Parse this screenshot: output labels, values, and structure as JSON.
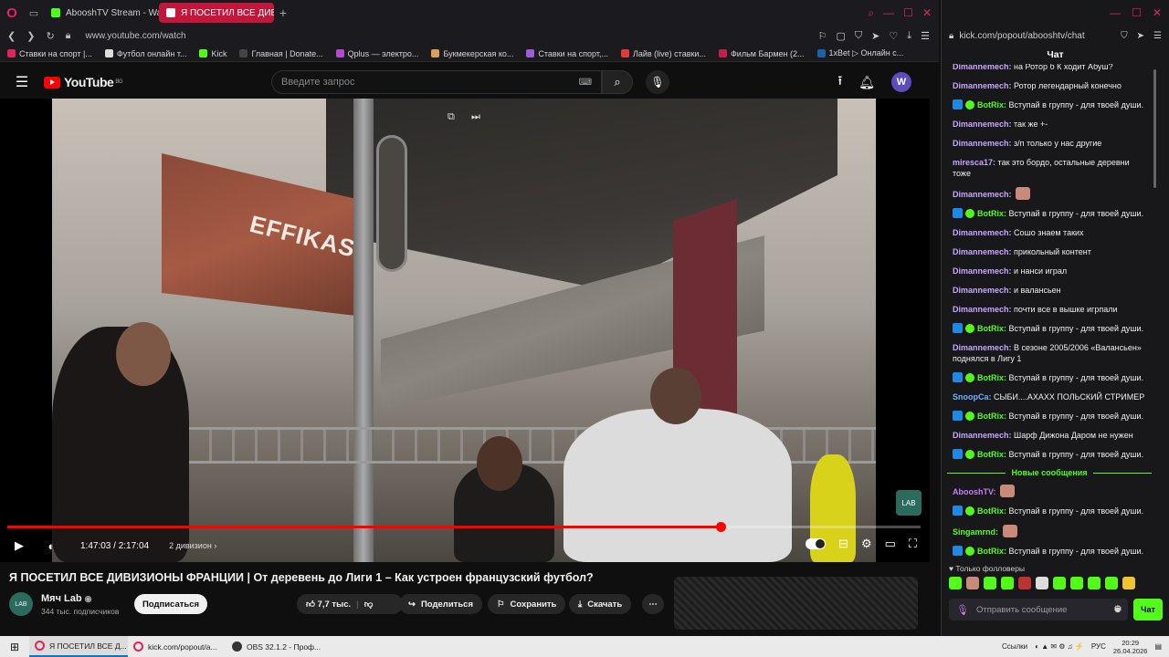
{
  "browser_tabs": [
    {
      "label": "AbooshTV Stream - Watch",
      "active": false
    },
    {
      "label": "Я ПОСЕТИЛ ВСЕ ДИВИЗИОНЫ",
      "active": true
    }
  ],
  "address": {
    "url": "www.youtube.com/watch"
  },
  "bookmarks": [
    "Ставки на спорт |...",
    "Футбол онлайн т...",
    "Kick",
    "Главная | Donate...",
    "Qplus — электро...",
    "Букмекерская ко...",
    "Ставки на спорт,...",
    "Лайв (live) ставки...",
    "Фильм Бармен (2...",
    "1xBet ▷ Онлайн с..."
  ],
  "youtube": {
    "logo_text": "YouTube",
    "region": "BG",
    "search_placeholder": "Введите запрос",
    "avatar_letter": "W"
  },
  "video": {
    "board_text": "EFFIKASS",
    "current_time": "1:47:03",
    "duration": "2:17:04",
    "time_display": "1:47:03 / 2:17:04",
    "chapter": "2 дивизион",
    "progress": 0.781,
    "title": "Я ПОСЕТИЛ ВСЕ ДИВИЗИОНЫ ФРАНЦИИ | От деревень до Лиги 1 – Как устроен французский футбол?",
    "channel_name": "Мяч Lab",
    "subscribers": "344 тыс. подписчиков",
    "subscribe_label": "Подписаться",
    "likes": "7,7 тыс.",
    "share_label": "Поделиться",
    "save_label": "Сохранить",
    "download_label": "Скачать"
  },
  "chat_window": {
    "url": "kick.com/popout/abooshtv/chat",
    "title": "Чат",
    "messages": [
      {
        "user": "Dimannemech",
        "color": "#c7a6ff",
        "text": "на Ротор б К ходит Абуш?",
        "bot": false
      },
      {
        "user": "Dimannemech",
        "color": "#c7a6ff",
        "text": "Ротор легендарный конечно",
        "bot": false
      },
      {
        "user": "BotRix",
        "color": "#53fc18",
        "text": "Вступай в группу - для твоей души.",
        "bot": true
      },
      {
        "user": "Dimannemech",
        "color": "#c7a6ff",
        "text": "так же +-",
        "bot": false
      },
      {
        "user": "Dimannemech",
        "color": "#c7a6ff",
        "text": "з/п только у нас другие",
        "bot": false
      },
      {
        "user": "miresca17",
        "color": "#c7a6ff",
        "text": "так это бордо, остальные деревни тоже",
        "bot": false
      },
      {
        "user": "Dimannemech",
        "color": "#c7a6ff",
        "text": "",
        "bot": false
      },
      {
        "user": "BotRix",
        "color": "#53fc18",
        "text": "Вступай в группу - для твоей души.",
        "bot": true
      },
      {
        "user": "Dimannemech",
        "color": "#c7a6ff",
        "text": "Сошо знаем таких",
        "bot": false
      },
      {
        "user": "Dimannemech",
        "color": "#c7a6ff",
        "text": "прикольный контент",
        "bot": false
      },
      {
        "user": "Dimannemech",
        "color": "#c7a6ff",
        "text": "и нанси играл",
        "bot": false
      },
      {
        "user": "Dimannemech",
        "color": "#c7a6ff",
        "text": "и валансьен",
        "bot": false
      },
      {
        "user": "Dimannemech",
        "color": "#c7a6ff",
        "text": "почти все в вышке игрпали",
        "bot": false
      },
      {
        "user": "BotRix",
        "color": "#53fc18",
        "text": "Вступай в группу - для твоей души.",
        "bot": true
      },
      {
        "user": "Dimannemech",
        "color": "#c7a6ff",
        "text": "В сезоне 2005/2006 «Валансьен» поднялся в Лигу 1",
        "bot": false
      },
      {
        "user": "BotRix",
        "color": "#53fc18",
        "text": "Вступай в группу - для твоей души.",
        "bot": true
      },
      {
        "user": "SnoopCa",
        "color": "#6fb3ff",
        "text": "СЫБИ....АХАХХ ПОЛЬСКИЙ СТРИМЕР",
        "bot": false
      },
      {
        "user": "BotRix",
        "color": "#53fc18",
        "text": "Вступай в группу - для твоей души.",
        "bot": true
      },
      {
        "user": "Dimannemech",
        "color": "#c7a6ff",
        "text": "Шарф Дижона Даром не нужен",
        "bot": false
      },
      {
        "user": "BotRix",
        "color": "#53fc18",
        "text": "Вступай в группу - для твоей души.",
        "bot": true
      }
    ],
    "new_messages_label": "Новые сообщения",
    "new_messages": [
      {
        "user": "AbooshTV",
        "color": "#c97cf7",
        "text": "",
        "bot": false
      },
      {
        "user": "BotRix",
        "color": "#53fc18",
        "text": "Вступай в группу - для твоей души.",
        "bot": true
      },
      {
        "user": "Singamrnd",
        "color": "#53fc18",
        "text": "",
        "bot": false
      },
      {
        "user": "BotRix",
        "color": "#53fc18",
        "text": "Вступай в группу - для твоей души.",
        "bot": true
      }
    ],
    "followers_only": "Только фолловеры",
    "input_placeholder": "Отправить сообщение",
    "send_label": "Чат"
  },
  "taskbar": {
    "items": [
      "Я ПОСЕТИЛ ВСЕ Д...",
      "kick.com/popout/a...",
      "OBS 32.1.2 - Проф..."
    ],
    "links_label": "Ссылки",
    "lang": "РУС",
    "time": "20:29",
    "date": "26.04.2026"
  }
}
